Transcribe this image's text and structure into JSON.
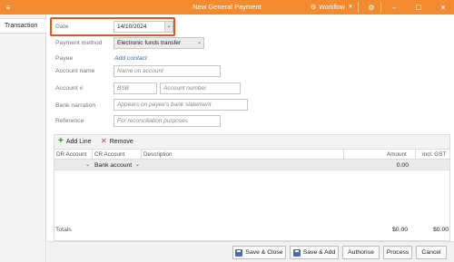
{
  "window": {
    "title": "New General Payment",
    "menu_icon": "hamburger-icon",
    "workflow_label": "Workflow",
    "controls": [
      "minimize-icon",
      "maximize-icon",
      "close-icon"
    ]
  },
  "sidebar": {
    "tabs": [
      {
        "label": "Transaction",
        "active": true
      }
    ]
  },
  "form": {
    "date": {
      "label": "Date",
      "value": "14/10/2024"
    },
    "payment_method": {
      "label": "Payment method",
      "value": "Electronic funds transfer"
    },
    "payee": {
      "label": "Payee",
      "link": "Add contact"
    },
    "account_name": {
      "label": "Account name",
      "placeholder": "Name on account"
    },
    "account_number": {
      "label": "Account #",
      "bsb_placeholder": "BSB",
      "number_placeholder": "Account number"
    },
    "bank_narration": {
      "label": "Bank narration",
      "placeholder": "Appears on payee's bank statement"
    },
    "reference": {
      "label": "Reference",
      "placeholder": "For reconciliation purposes"
    }
  },
  "lines": {
    "add_line": "Add Line",
    "remove": "Remove",
    "columns": [
      "DR Account",
      "CR Account",
      "Description",
      "Amount",
      "Incl. GST"
    ],
    "bank_row": {
      "label": "Bank account",
      "amount": "0.00"
    },
    "totals": {
      "label": "Totals",
      "amount": "$0.00",
      "gst": "$0.00"
    }
  },
  "footer": {
    "save_close": "Save & Close",
    "save_add": "Save & Add",
    "authorise": "Authorise",
    "process": "Process",
    "cancel": "Cancel"
  },
  "colors": {
    "titlebar": "#f28b30",
    "highlight": "#e9541b",
    "link": "#2a73c2"
  }
}
